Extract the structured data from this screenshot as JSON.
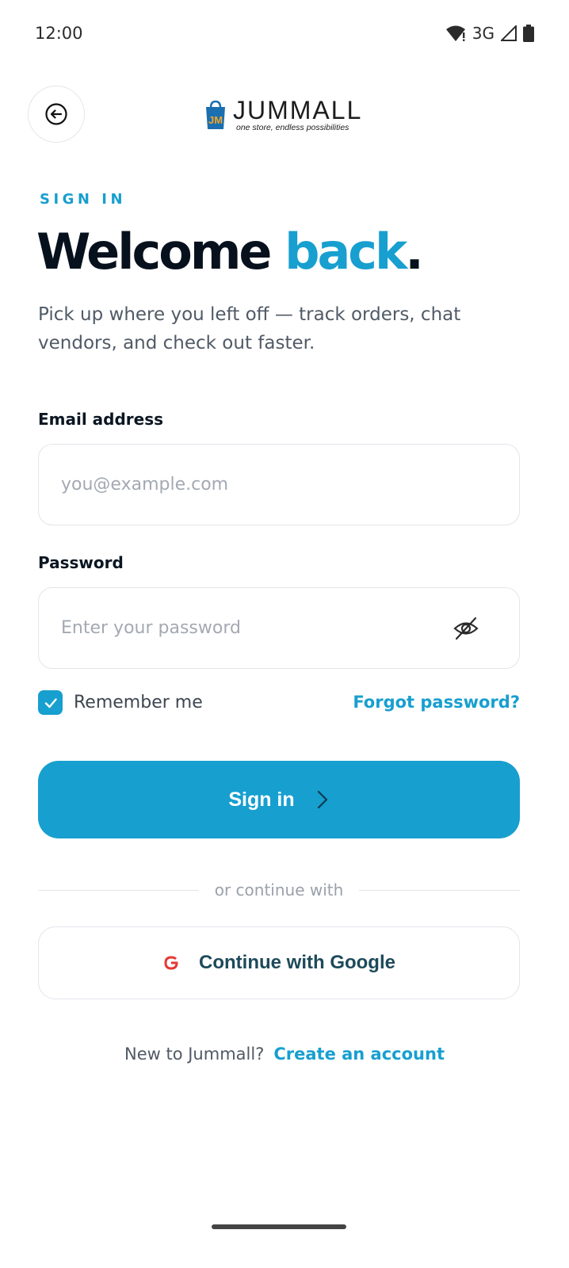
{
  "status_bar": {
    "time": "12:00",
    "network": "3G"
  },
  "brand": {
    "name": "JUMMALL",
    "tagline": "one store, endless possibilities",
    "colors": {
      "accent": "#179fcf",
      "dark": "#07111d"
    }
  },
  "intro": {
    "eyebrow": "SIGN IN",
    "headline_part1": "Welcome ",
    "headline_part2": "back",
    "headline_end": ".",
    "subtitle": "Pick up where you left off — track orders, chat vendors, and check out faster."
  },
  "form": {
    "email_label": "Email address",
    "email_placeholder": "you@example.com",
    "email_value": "",
    "password_label": "Password",
    "password_placeholder": "Enter your password",
    "password_value": "",
    "remember_label": "Remember me",
    "remember_checked": true,
    "forgot_label": "Forgot password?",
    "submit_label": "Sign in"
  },
  "social": {
    "divider_text": "or continue with",
    "google_label": "Continue with Google",
    "google_icon": "google-icon"
  },
  "footer": {
    "prompt": "New to Jummall?",
    "signup_link": "Create an account"
  },
  "icons": {
    "back": "back-arrow-icon",
    "password_toggle": "eye-off-icon",
    "submit": "chevron-right-icon"
  }
}
